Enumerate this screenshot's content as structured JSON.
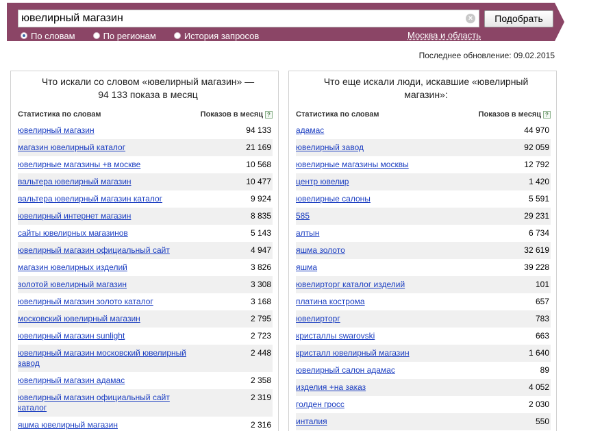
{
  "search": {
    "query": "ювелирный магазин",
    "submit_label": "Подобрать",
    "clear_symbol": "×",
    "modes": [
      {
        "label": "По словам",
        "selected": true
      },
      {
        "label": "По регионам",
        "selected": false
      },
      {
        "label": "История запросов",
        "selected": false
      }
    ],
    "region": "Москва и область"
  },
  "last_update": "Последнее обновление: 09.02.2015",
  "left_panel": {
    "title": "Что искали со словом «ювелирный магазин» — 94 133 показа в месяц",
    "col_keyword": "Статистика по словам",
    "col_count": "Показов в месяц",
    "rows": [
      {
        "keyword": "ювелирный магазин",
        "count": "94 133"
      },
      {
        "keyword": "магазин ювелирный каталог",
        "count": "21 169"
      },
      {
        "keyword": "ювелирные магазины +в москве",
        "count": "10 568"
      },
      {
        "keyword": "вальтера ювелирный магазин",
        "count": "10 477"
      },
      {
        "keyword": "вальтера ювелирный магазин каталог",
        "count": "9 924"
      },
      {
        "keyword": "ювелирный интернет магазин",
        "count": "8 835"
      },
      {
        "keyword": "сайты ювелирных магазинов",
        "count": "5 143"
      },
      {
        "keyword": "ювелирный магазин официальный сайт",
        "count": "4 947"
      },
      {
        "keyword": "магазин ювелирных изделий",
        "count": "3 826"
      },
      {
        "keyword": "золотой ювелирный магазин",
        "count": "3 308"
      },
      {
        "keyword": "ювелирный магазин золото каталог",
        "count": "3 168"
      },
      {
        "keyword": "московский ювелирный магазин",
        "count": "2 795"
      },
      {
        "keyword": "ювелирный магазин sunlight",
        "count": "2 723"
      },
      {
        "keyword": "ювелирный магазин московский ювелирный завод",
        "count": "2 448"
      },
      {
        "keyword": "ювелирный магазин адамас",
        "count": "2 358"
      },
      {
        "keyword": "ювелирный магазин официальный сайт каталог",
        "count": "2 319"
      },
      {
        "keyword": "яшма ювелирный магазин",
        "count": "2 316"
      }
    ]
  },
  "right_panel": {
    "title": "Что еще искали люди, искавшие «ювелирный магазин»:",
    "col_keyword": "Статистика по словам",
    "col_count": "Показов в месяц",
    "rows": [
      {
        "keyword": "адамас",
        "count": "44 970"
      },
      {
        "keyword": "ювелирный завод",
        "count": "92 059"
      },
      {
        "keyword": "ювелирные магазины москвы",
        "count": "12 792"
      },
      {
        "keyword": "центр ювелир",
        "count": "1 420"
      },
      {
        "keyword": "ювелирные салоны",
        "count": "5 591"
      },
      {
        "keyword": "585",
        "count": "29 231"
      },
      {
        "keyword": "алтын",
        "count": "6 734"
      },
      {
        "keyword": "яшма золото",
        "count": "32 619"
      },
      {
        "keyword": "яшма",
        "count": "39 228"
      },
      {
        "keyword": "ювелирторг каталог изделий",
        "count": "101"
      },
      {
        "keyword": "платина кострома",
        "count": "657"
      },
      {
        "keyword": "ювелирторг",
        "count": "783"
      },
      {
        "keyword": "кристаллы swarovski",
        "count": "663"
      },
      {
        "keyword": "кристалл ювелирный магазин",
        "count": "1 640"
      },
      {
        "keyword": "ювелирный салон адамас",
        "count": "89"
      },
      {
        "keyword": "изделия +на заказ",
        "count": "4 052"
      },
      {
        "keyword": "голден гросс",
        "count": "2 030"
      },
      {
        "keyword": "инталия",
        "count": "550"
      }
    ]
  },
  "help_symbol": "?"
}
